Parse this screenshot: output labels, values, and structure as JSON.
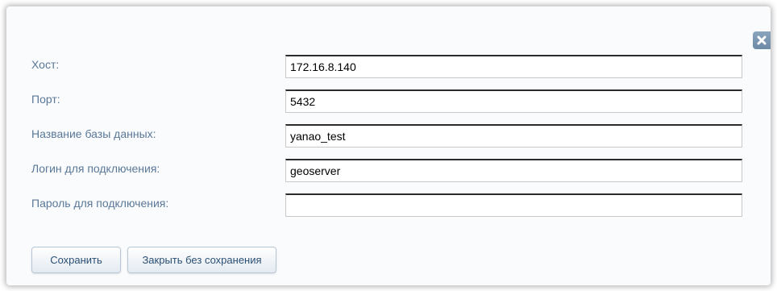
{
  "form": {
    "fields": [
      {
        "label": "Хост:",
        "value": "172.16.8.140"
      },
      {
        "label": "Порт:",
        "value": "5432"
      },
      {
        "label": "Название базы данных:",
        "value": "yanao_test"
      },
      {
        "label": "Логин для подключения:",
        "value": "geoserver"
      },
      {
        "label": "Пароль для подключения:",
        "value": ""
      }
    ]
  },
  "buttons": {
    "save": "Сохранить",
    "close_without_saving": "Закрыть без сохранения"
  },
  "icons": {
    "close": "close-icon"
  },
  "colors": {
    "label": "#5a7897",
    "button_text": "#2a4f74",
    "close_button": "#7893ad"
  }
}
